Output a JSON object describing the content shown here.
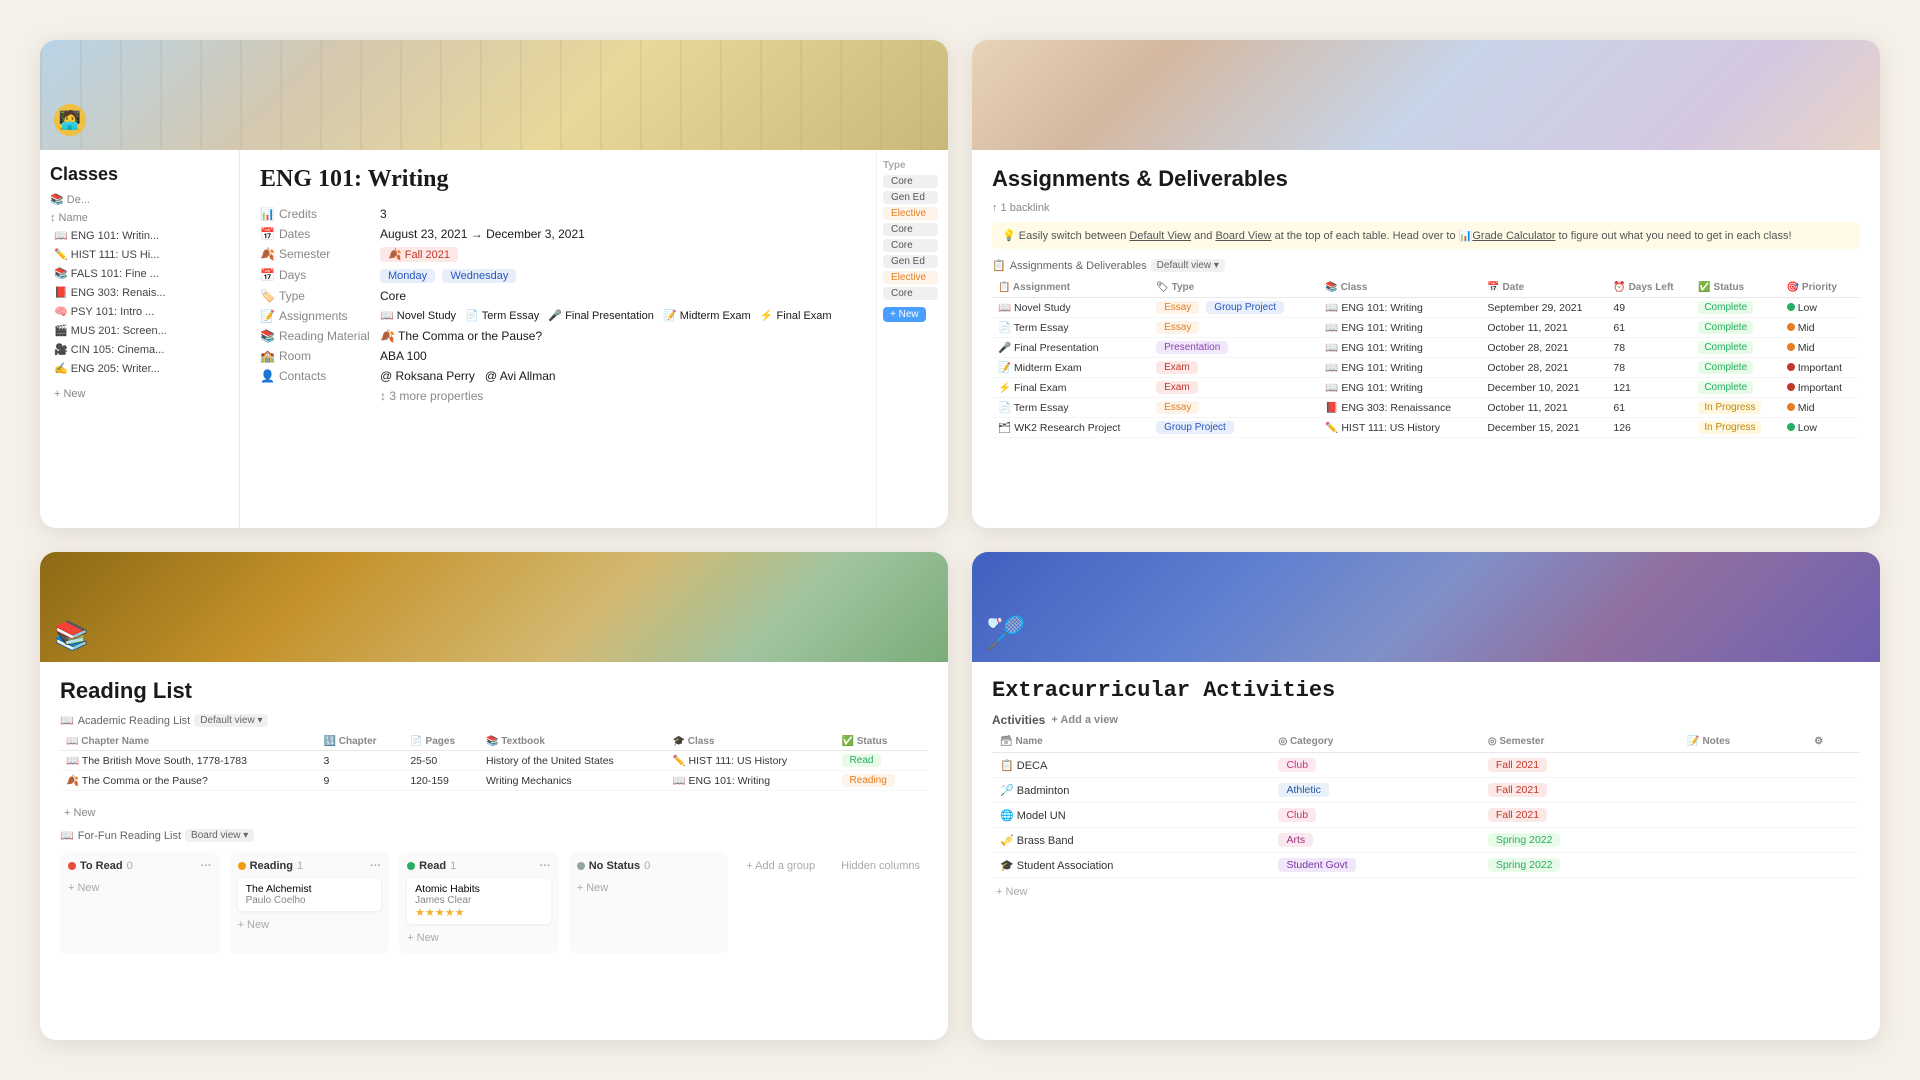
{
  "cards": {
    "classes": {
      "title": "Classes",
      "header_bg": "classroom",
      "avatar_emoji": "🧑‍💻",
      "sidebar_title": "Classes",
      "sidebar_label": "📚 De...",
      "sidebar_items": [
        {
          "emoji": "📖",
          "text": "ENG 101: Writin..."
        },
        {
          "emoji": "✏️",
          "text": "HIST 111: US Hi..."
        },
        {
          "emoji": "📚",
          "text": "FALS 101: Fine ..."
        },
        {
          "emoji": "📕",
          "text": "ENG 303: Renais..."
        },
        {
          "emoji": "🧠",
          "text": "PSY 101: Intro ..."
        },
        {
          "emoji": "🎬",
          "text": "MUS 201: Screen..."
        },
        {
          "emoji": "🎥",
          "text": "CIN 105: Cinema..."
        },
        {
          "emoji": "✍️",
          "text": "ENG 205: Writer..."
        }
      ],
      "new_button": "+ New",
      "detail": {
        "title": "ENG 101: Writing",
        "properties": [
          {
            "label": "Credits",
            "icon": "📊",
            "value": "3"
          },
          {
            "label": "Dates",
            "icon": "📅",
            "value": "August 23, 2021 → December 3, 2021"
          },
          {
            "label": "Semester",
            "icon": "🍂",
            "value": "Fall 2021",
            "tag": true,
            "tag_class": "tag-red"
          },
          {
            "label": "Days",
            "icon": "📅",
            "value_tags": [
              "Monday",
              "Wednesday"
            ]
          },
          {
            "label": "Type",
            "icon": "🏷️",
            "value": "Core"
          },
          {
            "label": "Assignments",
            "icon": "📝",
            "values": [
              "📖 Novel Study",
              "📄 Term Essay",
              "🎤 Final Presentation",
              "📝 Midterm Exam",
              "⚡ Final Exam"
            ]
          },
          {
            "label": "Reading Material",
            "icon": "📚",
            "value": "🍂 The Comma or the Pause?"
          },
          {
            "label": "Room",
            "icon": "🏫",
            "value": "ABA 100"
          },
          {
            "label": "Contacts",
            "icon": "👤",
            "values": [
              "@ Roksana Perry",
              "@ Avi Allman"
            ]
          },
          {
            "label": "",
            "icon": "",
            "value": "↕ 3 more properties"
          }
        ]
      },
      "type_tags": [
        {
          "text": "Core",
          "class": "tag-gray"
        },
        {
          "text": "Gen Ed",
          "class": "tag-gray"
        },
        {
          "text": "Elective",
          "class": "tag-orange"
        },
        {
          "text": "Core",
          "class": "tag-gray"
        },
        {
          "text": "Core",
          "class": "tag-gray"
        },
        {
          "text": "Gen Ed",
          "class": "tag-gray"
        },
        {
          "text": "Elective",
          "class": "tag-orange"
        },
        {
          "text": "Core",
          "class": "tag-gray"
        }
      ]
    },
    "assignments": {
      "title": "Assignments & Deliverables",
      "header_bg": "assignments",
      "backlink": "↑ 1 backlink",
      "info_text": "💡 Easily switch between Default View and Board View at the top of each table. Head over to 📊Grade Calculator to figure out what you need to get in each class!",
      "section_title": "📋 Assignments & Deliverables",
      "view_label": "Default view",
      "columns": [
        "Assignment",
        "Type",
        "Class",
        "Date",
        "Days Left",
        "Status",
        "Priority"
      ],
      "rows": [
        {
          "name": "📖 Novel Study",
          "type": "Essay Group Project",
          "type_classes": [
            "tag-orange small-tag",
            "tag-blue small-tag"
          ],
          "class": "📖 ENG 101: Writing",
          "date": "September 29, 2021",
          "days": "49",
          "status": "Complete",
          "status_class": "status-complete",
          "priority": "Low",
          "dot": "dot-low"
        },
        {
          "name": "📄 Term Essay",
          "type": "Essay",
          "type_classes": [
            "tag-orange small-tag"
          ],
          "class": "📖 ENG 101: Writing",
          "date": "October 11, 2021",
          "days": "61",
          "status": "Complete",
          "status_class": "status-complete",
          "priority": "Mid",
          "dot": "dot-mid"
        },
        {
          "name": "🎤 Final Presentation",
          "type": "Presentation",
          "type_classes": [
            "tag-purple small-tag"
          ],
          "class": "📖 ENG 101: Writing",
          "date": "October 28, 2021",
          "days": "78",
          "status": "Complete",
          "status_class": "status-complete",
          "priority": "Mid",
          "dot": "dot-mid"
        },
        {
          "name": "📝 Midterm Exam",
          "type": "Exam",
          "type_classes": [
            "tag-red small-tag"
          ],
          "class": "📖 ENG 101: Writing",
          "date": "October 28, 2021",
          "days": "78",
          "status": "Complete",
          "status_class": "status-complete",
          "priority": "Important",
          "dot": "dot-important"
        },
        {
          "name": "⚡ Final Exam",
          "type": "Exam",
          "type_classes": [
            "tag-red small-tag"
          ],
          "class": "📖 ENG 101: Writing",
          "date": "December 10, 2021",
          "days": "121",
          "status": "Complete",
          "status_class": "status-complete",
          "priority": "Important",
          "dot": "dot-important"
        },
        {
          "name": "📄 Term Essay",
          "type": "Essay",
          "type_classes": [
            "tag-orange small-tag"
          ],
          "class": "📕 ENG 303: Renaissance",
          "date": "October 11, 2021",
          "days": "61",
          "status": "In Progress",
          "status_class": "status-inprogress",
          "priority": "Mid",
          "dot": "dot-mid"
        },
        {
          "name": "🗂 WK2 Research Project",
          "type": "Group Project",
          "type_classes": [
            "tag-blue small-tag"
          ],
          "class": "✏️ HIST 111: US History",
          "date": "December 15, 2021",
          "days": "126",
          "status": "In Progress",
          "status_class": "status-inprogress",
          "priority": "Low",
          "dot": "dot-low"
        }
      ]
    },
    "reading": {
      "title": "Reading List",
      "header_bg": "library",
      "books_emoji": "📚",
      "section1_title": "📖 Academic Reading List",
      "section1_view": "Default view",
      "cols1": [
        "Chapter Name",
        "Chapter",
        "Pages",
        "Textbook",
        "Class",
        "Status"
      ],
      "rows1": [
        {
          "name": "📖 The British Move South, 1778-1783",
          "chapter": "3",
          "pages": "25-50",
          "textbook": "History of the United States",
          "class": "✏️ HIST 111: US History",
          "status": "Read",
          "status_class": "tag-green"
        },
        {
          "name": "🍂 The Comma or the Pause?",
          "chapter": "9",
          "pages": "120-159",
          "textbook": "Writing Mechanics",
          "class": "📖 ENG 101: Writing",
          "status": "Reading",
          "status_class": "tag-orange"
        }
      ],
      "section2_title": "📖 For-Fun Reading List",
      "section2_view": "Board view",
      "kanban_cols": [
        {
          "title": "To Read",
          "count": "0",
          "color": "#e74c3c",
          "cards": []
        },
        {
          "title": "Reading",
          "count": "1",
          "color": "#f39c12",
          "cards": [
            {
              "title": "The Alchemist",
              "subtitle": "Paulo Coelho"
            }
          ]
        },
        {
          "title": "Read",
          "count": "1",
          "color": "#27ae60",
          "cards": [
            {
              "title": "Atomic Habits",
              "subtitle": "James Clear",
              "has_stars": true
            }
          ]
        },
        {
          "title": "No Status",
          "count": "0",
          "color": "#95a5a6",
          "cards": []
        }
      ],
      "add_group": "+ Add a group",
      "hidden_cols": "Hidden columns"
    },
    "extracurricular": {
      "title": "Extracurricular Activities",
      "header_bg": "sports",
      "emoji": "🏸",
      "section_title": "Activities",
      "add_view": "+ Add a view",
      "columns": [
        "Name",
        "Category",
        "Semester",
        "Notes"
      ],
      "rows": [
        {
          "emoji": "📋",
          "name": "DECA",
          "category": "Club",
          "cat_class": "cat-club",
          "semester": "Fall 2021",
          "sem_class": "sem-fall2021"
        },
        {
          "emoji": "🏸",
          "name": "Badminton",
          "category": "Athletic",
          "cat_class": "cat-athletic",
          "semester": "Fall 2021",
          "sem_class": "sem-fall2021"
        },
        {
          "emoji": "🌐",
          "name": "Model UN",
          "category": "Club",
          "cat_class": "cat-club2",
          "semester": "Fall 2021",
          "sem_class": "sem-fall2021"
        },
        {
          "emoji": "🎺",
          "name": "Brass Band",
          "category": "Arts",
          "cat_class": "cat-arts",
          "semester": "Spring 2022",
          "sem_class": "sem-spring2022"
        },
        {
          "emoji": "🎓",
          "name": "Student Association",
          "category": "Student Govt",
          "cat_class": "cat-studentgovt",
          "semester": "Spring 2022",
          "sem_class": "sem-spring2022"
        }
      ]
    }
  }
}
